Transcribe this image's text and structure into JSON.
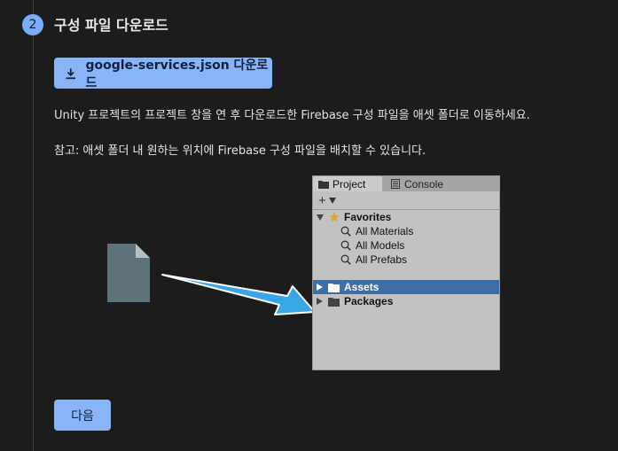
{
  "step": {
    "number": "2",
    "title": "구성 파일 다운로드"
  },
  "download_button": {
    "label": "google-services.json 다운로드",
    "icon": "download-icon"
  },
  "instructions": {
    "line1": "Unity 프로젝트의 프로젝트 창을 연 후 다운로드한 Firebase 구성 파일을 애셋 폴더로 이동하세요.",
    "line2": "참고: 애셋 폴더 내 원하는 위치에 Firebase 구성 파일을 배치할 수 있습니다."
  },
  "unity_panel": {
    "tabs": {
      "project": "Project",
      "console": "Console"
    },
    "toolbar_add": "+",
    "favorites": {
      "label": "Favorites",
      "items": [
        "All Materials",
        "All Models",
        "All Prefabs"
      ]
    },
    "assets": "Assets",
    "packages": "Packages",
    "selected_row_color": "#3e6ea8"
  },
  "next_button": {
    "label": "다음"
  },
  "colors": {
    "accent": "#8ab4f8",
    "background": "#1c1c1c"
  }
}
